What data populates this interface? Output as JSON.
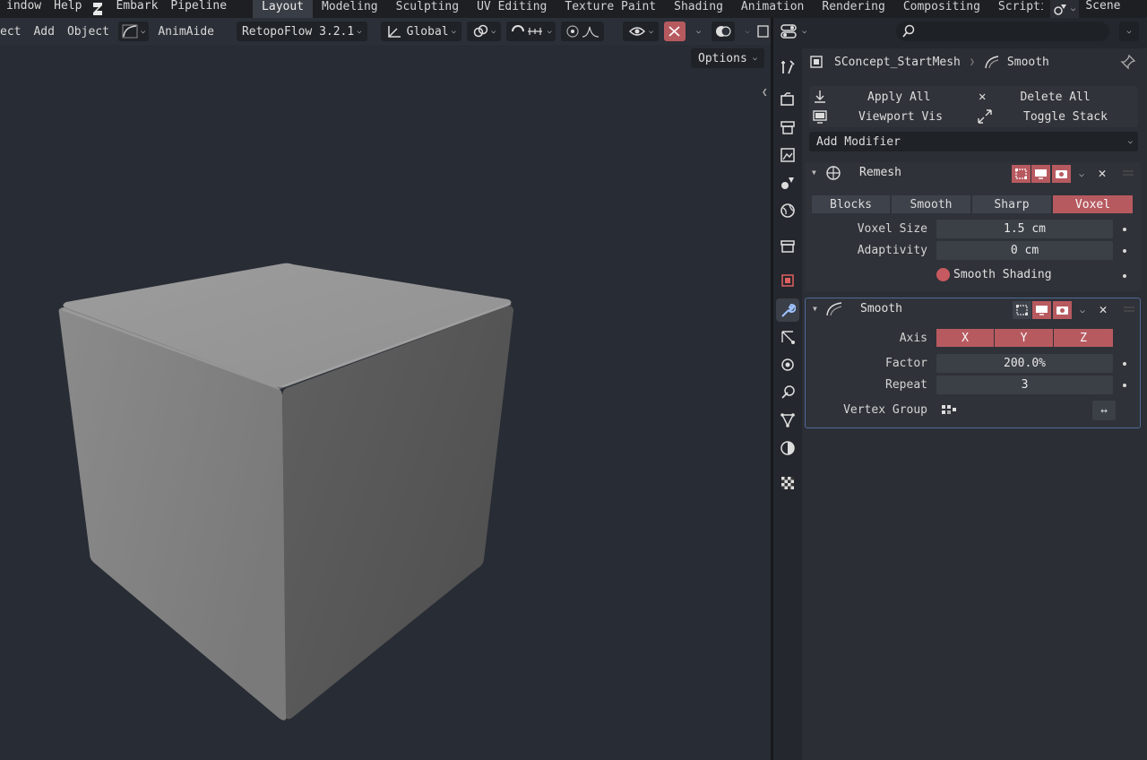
{
  "topbar": {
    "menus": [
      "indow",
      "Help"
    ],
    "logo_icon": "embark-logo-icon",
    "extra_menus": [
      "Embark",
      "Pipeline"
    ],
    "workspaces": [
      "Layout",
      "Modeling",
      "Sculpting",
      "UV Editing",
      "Texture Paint",
      "Shading",
      "Animation",
      "Rendering",
      "Compositing",
      "Scripti"
    ],
    "active_workspace": "Layout",
    "scene_label": "Scene"
  },
  "toolbar": {
    "menus": [
      "ect",
      "Add",
      "Object"
    ],
    "animaide": "AnimAide",
    "retopoflow": "RetopoFlow 3.2.1",
    "orientation": "Global",
    "options_label": "Options"
  },
  "properties": {
    "context_object": "SConcept_StartMesh",
    "context_modifier": "Smooth",
    "apply_all": "Apply All",
    "delete_all": "Delete All",
    "viewport_vis": "Viewport Vis",
    "toggle_stack": "Toggle Stack",
    "add_modifier": "Add Modifier"
  },
  "remesh": {
    "name": "Remesh",
    "modes": [
      "Blocks",
      "Smooth",
      "Sharp",
      "Voxel"
    ],
    "active_mode": "Voxel",
    "voxel_size_label": "Voxel Size",
    "voxel_size": "1.5 cm",
    "adaptivity_label": "Adaptivity",
    "adaptivity": "0 cm",
    "smooth_shading_label": "Smooth Shading",
    "smooth_shading": true
  },
  "smooth": {
    "name": "Smooth",
    "axis_label": "Axis",
    "axes": [
      "X",
      "Y",
      "Z"
    ],
    "factor_label": "Factor",
    "factor": "200.0%",
    "repeat_label": "Repeat",
    "repeat": "3",
    "vertex_group_label": "Vertex Group"
  },
  "colors": {
    "accent_red": "#b75a60",
    "active_border": "#4f6b9a",
    "viewport_bg": "#282c34"
  }
}
